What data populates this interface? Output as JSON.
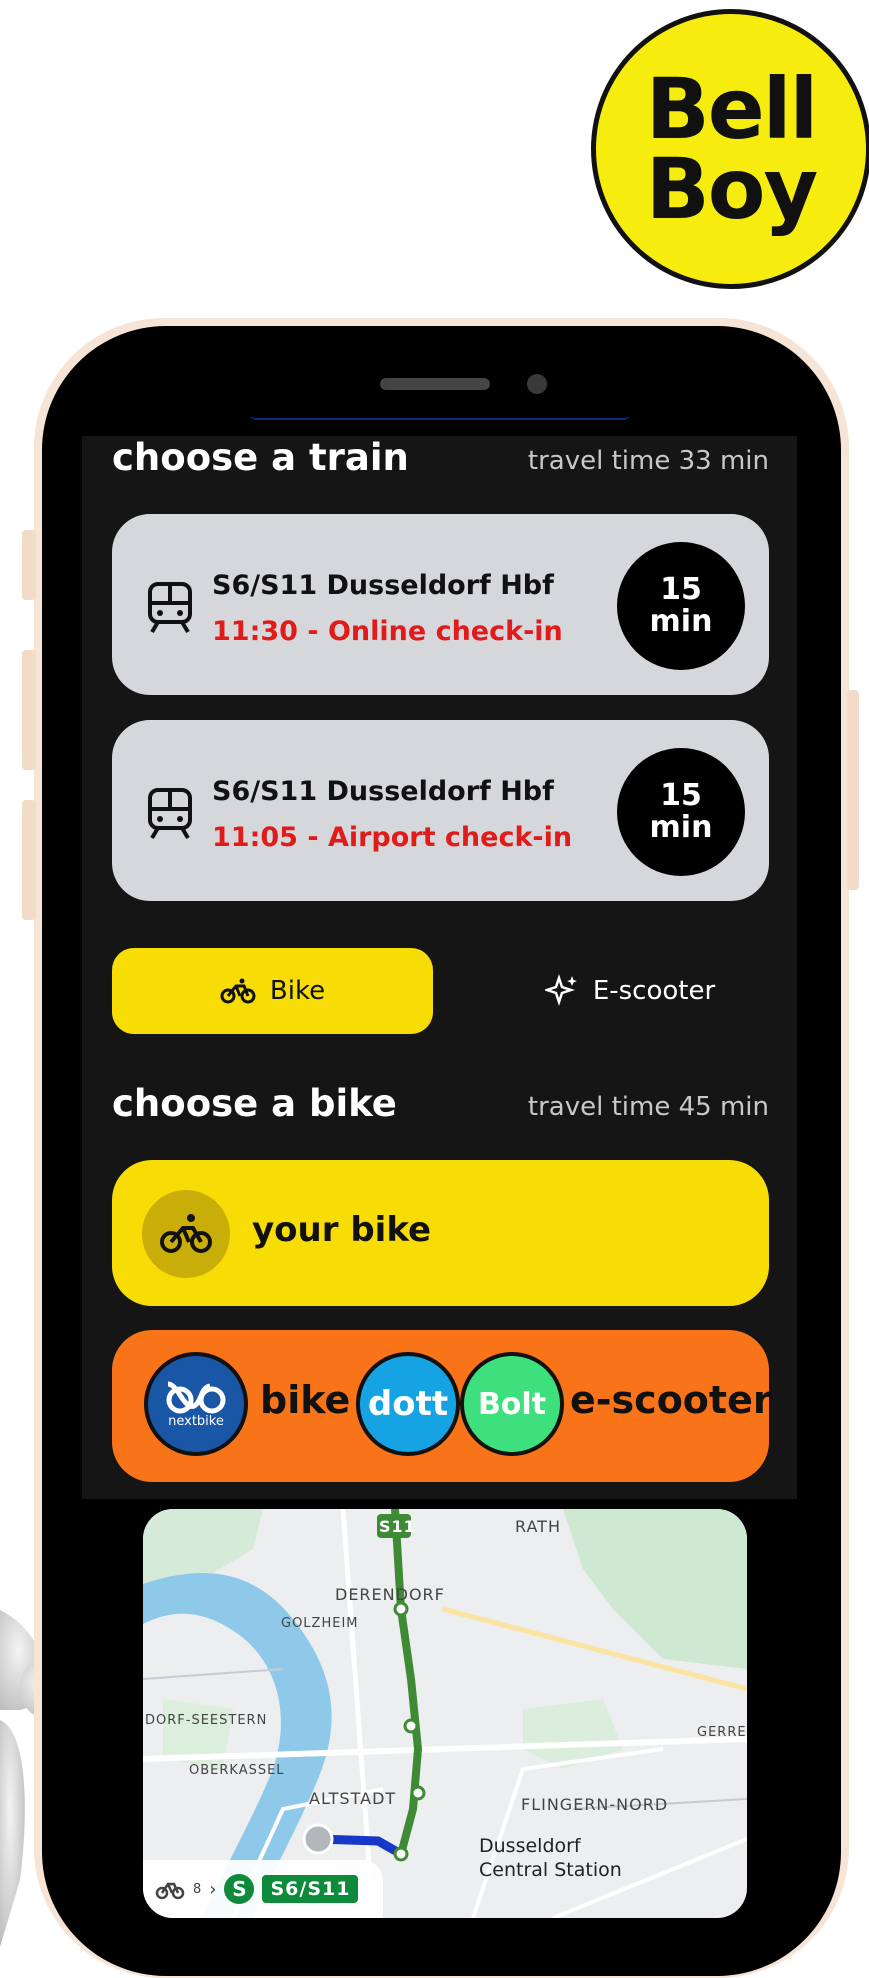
{
  "logo": {
    "line1": "Bell",
    "line2": "Boy"
  },
  "train_section": {
    "title": "choose a train",
    "travel_time": "travel time 33 min",
    "trains": [
      {
        "name": "S6/S11 Dusseldorf Hbf",
        "detail": "11:30 - Online check-in",
        "duration_value": "15",
        "duration_unit": "min"
      },
      {
        "name": "S6/S11 Dusseldorf Hbf",
        "detail": "11:05 - Airport check-in",
        "duration_value": "15",
        "duration_unit": "min"
      }
    ]
  },
  "mode_tabs": {
    "bike": "Bike",
    "scooter": "E-scooter"
  },
  "bike_section": {
    "title": "choose a bike",
    "travel_time": "travel time 45 min",
    "your_bike": "your bike",
    "share": {
      "nextbike_logo": "nextbike",
      "bike_label": "bike",
      "dott_logo": "dott",
      "bolt_logo": "Bolt",
      "scooter_label": "e-scooter"
    }
  },
  "map": {
    "line_badge": "S11",
    "labels": {
      "rath": "RATH",
      "derendorf": "DERENDORF",
      "golzheim": "GOLZHEIM",
      "dorf_seestern": "DORF-SEESTERN",
      "oberkassel": "OBERKASSEL",
      "altstadt": "ALTSTADT",
      "flingern": "FLINGERN-NORD",
      "gerre": "GERRE",
      "station1": "Dusseldorf",
      "station2": "Central Station"
    },
    "footer": {
      "bike_count": "8",
      "arrow": "›",
      "s_logo": "S",
      "lines": "S6/S11"
    }
  },
  "colors": {
    "accent_yellow": "#f7dc06",
    "accent_orange": "#f97418",
    "alert_red": "#e11a1a",
    "rail_green": "#3f8a35"
  }
}
